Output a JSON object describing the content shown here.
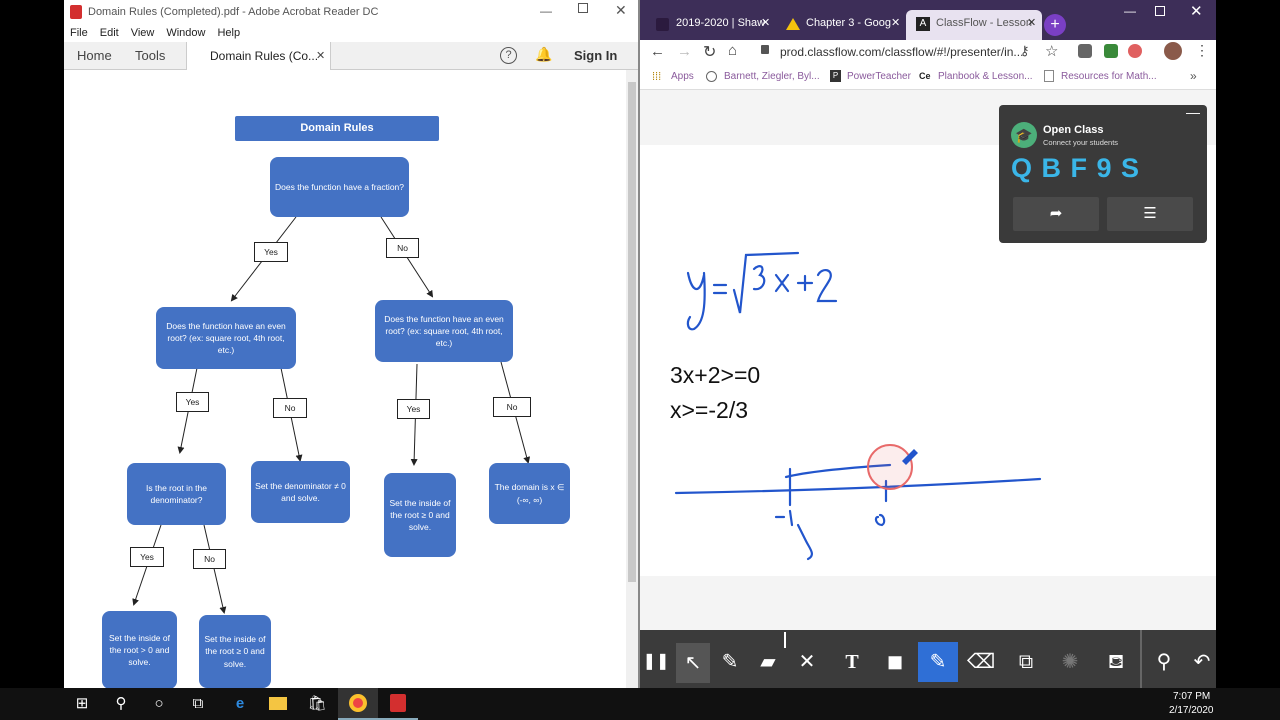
{
  "acrobat": {
    "window_title": "Domain Rules (Completed).pdf - Adobe Acrobat Reader DC",
    "menu": [
      "File",
      "Edit",
      "View",
      "Window",
      "Help"
    ],
    "tabs": {
      "home": "Home",
      "tools": "Tools",
      "doc": "Domain Rules (Co..."
    },
    "sign_in": "Sign In",
    "flowchart": {
      "title": "Domain Rules",
      "q1": "Does the function have a fraction?",
      "yes": "Yes",
      "no": "No",
      "q2a": "Does the function have an even root? (ex: square root, 4th root, etc.)",
      "q2b": "Does the function have an even root? (ex: square root, 4th root, etc.)",
      "q3": "Is the root in the denominator?",
      "r_denominator": "Set the denominator ≠ 0 and solve.",
      "r_root_b": "Set the inside of the root ≥ 0 and solve.",
      "r_all_reals": "The domain is x ∈ (-∞, ∞)",
      "r_root_gt": "Set the inside of the root > 0 and solve.",
      "r_root_ge": "Set the inside of the root ≥ 0 and solve."
    }
  },
  "chrome": {
    "tabs": [
      "2019-2020 | Shaw",
      "Chapter 3 - Goog",
      "ClassFlow - Lesson"
    ],
    "url": "prod.classflow.com/classflow/#!/presenter/in...",
    "bookmarks": [
      "Apps",
      "Barnett, Ziegler, Byl...",
      "PowerTeacher",
      "Planbook & Lesson...",
      "Resources for Math..."
    ],
    "open_class": {
      "title": "Open Class",
      "subtitle": "Connect your students",
      "code": "Q B F 9 S"
    },
    "canvas": {
      "line1": "3x+2>=0",
      "line2": "x>=-2/3"
    }
  },
  "taskbar": {
    "time": "7:07 PM",
    "date": "2/17/2020"
  },
  "colors": {
    "flow_blue": "#4472c4",
    "ink_blue": "#2255cc",
    "chrome_tabbar": "#3d2e58",
    "code_cyan": "#3ab6e8"
  }
}
